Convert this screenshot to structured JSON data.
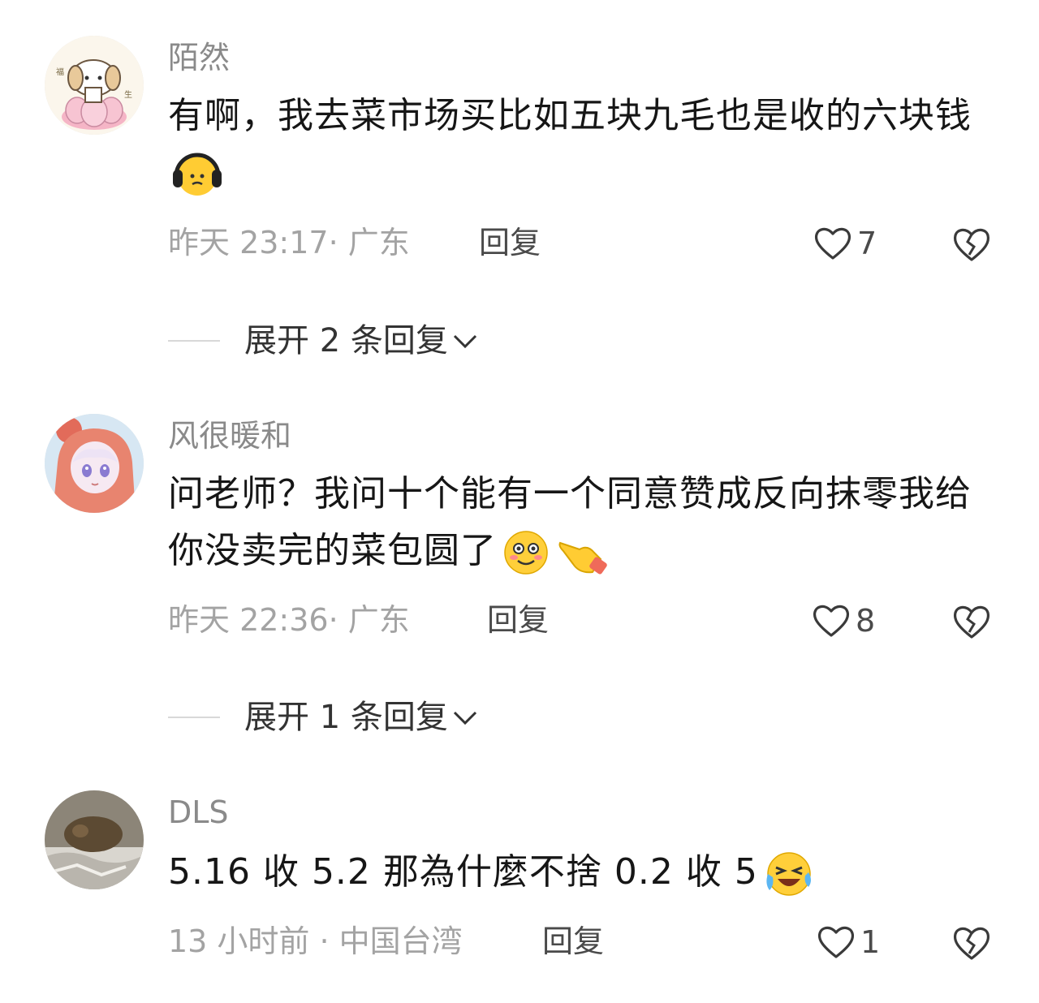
{
  "comments": [
    {
      "username": "陌然",
      "text": "有啊，我去菜市场买比如五块九毛也是收的六块钱",
      "time_location": "昨天 23:17· 广东",
      "reply_label": "回复",
      "likes": "7",
      "expand_label": "展开 2 条回复",
      "emojis": [
        "headphones-face-emoji"
      ]
    },
    {
      "username": "风很暖和",
      "text": "问老师？我问十个能有一个同意赞成反向抹零我给你没卖完的菜包圆了",
      "time_location": "昨天 22:36· 广东",
      "reply_label": "回复",
      "likes": "8",
      "expand_label": "展开 1 条回复",
      "emojis": [
        "blushing-face-emoji",
        "pointing-hand-emoji"
      ]
    },
    {
      "username": "DLS",
      "text": "5.16 收 5.2 那為什麼不捨 0.2 收 5",
      "time_location": "13 小时前 · 中国台湾",
      "reply_label": "回复",
      "likes": "1",
      "emojis": [
        "laughing-tears-emoji"
      ]
    }
  ],
  "colors": {
    "username": "#8a8a8a",
    "text": "#161616",
    "meta": "#a3a3a3",
    "action": "#4a4a4a"
  }
}
